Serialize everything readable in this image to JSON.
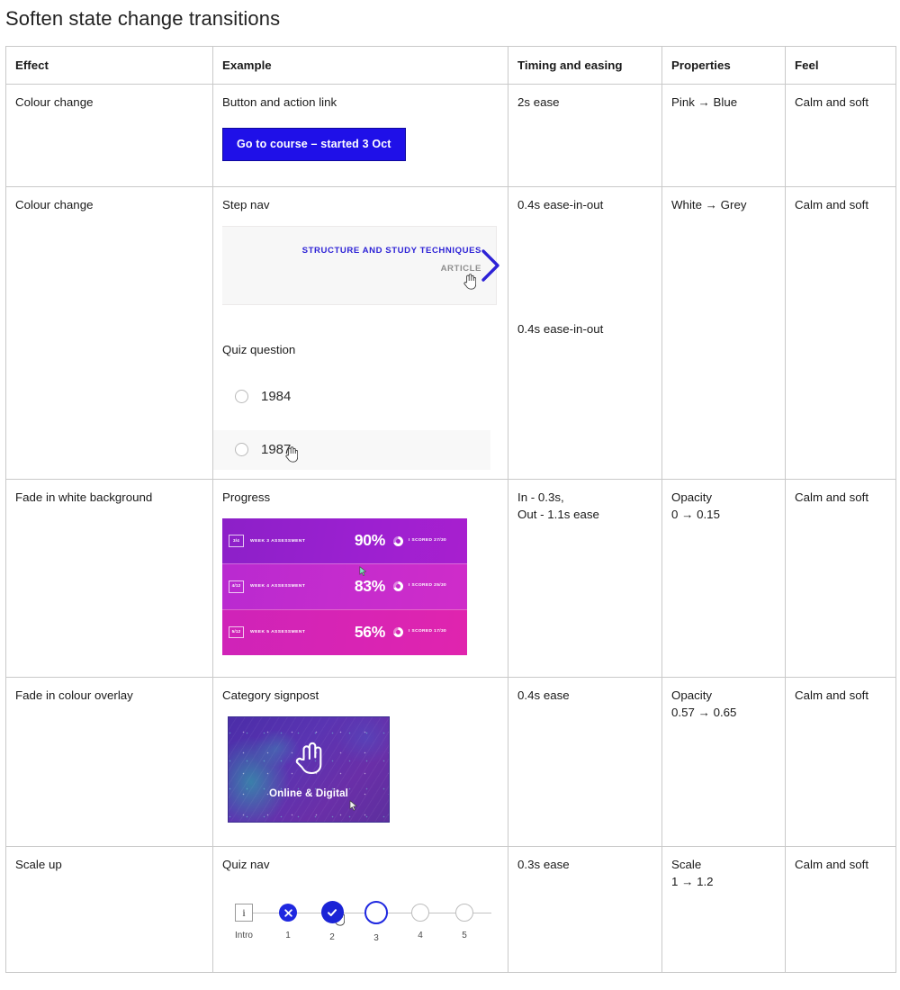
{
  "page": {
    "title": "Soften state change transitions"
  },
  "table": {
    "headers": [
      "Effect",
      "Example",
      "Timing and easing",
      "Properties",
      "Feel"
    ],
    "rows": [
      {
        "effect": "Colour change",
        "example_label": "Button and action link",
        "timing": "2s ease",
        "properties": "Pink → Blue",
        "feel": "Calm and soft",
        "demo": {
          "type": "cta-button",
          "button_label": "Go to course – started 3 Oct",
          "button_bg": "#1f10e8",
          "button_text_color": "#ffffff"
        }
      },
      {
        "effect": "Colour change",
        "example_label": "Step nav",
        "example_label_2": "Quiz question",
        "timing": "0.4s ease-in-out",
        "timing_2": "0.4s ease-in-out",
        "properties": "White → Grey",
        "feel": "Calm and soft",
        "stepnav": {
          "title": "STRUCTURE AND STUDY TECHNIQUES",
          "kind": "ARTICLE",
          "title_color": "#2d22d6",
          "kind_color": "#8e8e8e",
          "panel_bg": "#f7f7f7",
          "chevron_color": "#2d22d6"
        },
        "quiz": {
          "options": [
            {
              "label": "1984",
              "hovered": false
            },
            {
              "label": "1987",
              "hovered": true
            }
          ],
          "hover_bg": "#f8f8f8"
        }
      },
      {
        "effect": "Fade in white background",
        "example_label": "Progress",
        "timing": "In - 0.3s,\nOut - 1.1s ease",
        "timing_line_1": "In - 0.3s,",
        "timing_line_2": "Out - 1.1s ease",
        "properties_label": "Opacity",
        "properties_value": "0 → 0.15",
        "feel": "Calm and soft",
        "progress_rows": [
          {
            "badge": "3/4",
            "name": "WEEK 3 ASSESSMENT",
            "percent": "90%",
            "score": "I SCORED 27/30",
            "color": "#a420cb"
          },
          {
            "badge": "4/12",
            "name": "WEEK 4 ASSESSMENT",
            "percent": "83%",
            "score": "I SCORED 25/30",
            "color": "#c52ccd"
          },
          {
            "badge": "5/12",
            "name": "WEEK 5 ASSESSMENT",
            "percent": "56%",
            "score": "I SCORED 17/30",
            "color": "#d824b4"
          }
        ]
      },
      {
        "effect": "Fade in colour overlay",
        "example_label": "Category signpost",
        "timing": "0.4s ease",
        "properties_label": "Opacity",
        "properties_value": "0.57 → 0.65",
        "feel": "Calm and soft",
        "signpost": {
          "label": "Online & Digital",
          "icon": "tap-hand-icon",
          "base_color": "#5a34b2",
          "accent_color": "#22bea5"
        }
      },
      {
        "effect": "Scale up",
        "example_label": "Quiz nav",
        "timing": "0.3s ease",
        "properties_label": "Scale",
        "properties_value": "1 → 1.2",
        "feel": "Calm and soft",
        "quiznav": {
          "accent_color": "#1f28e0",
          "steps": [
            {
              "label": "Intro",
              "state": "intro",
              "glyph": "i"
            },
            {
              "label": "1",
              "state": "incorrect",
              "glyph": "×"
            },
            {
              "label": "2",
              "state": "correct-scaled",
              "glyph": "✓"
            },
            {
              "label": "3",
              "state": "current",
              "glyph": ""
            },
            {
              "label": "4",
              "state": "empty",
              "glyph": ""
            },
            {
              "label": "5",
              "state": "empty",
              "glyph": ""
            }
          ]
        }
      }
    ]
  }
}
